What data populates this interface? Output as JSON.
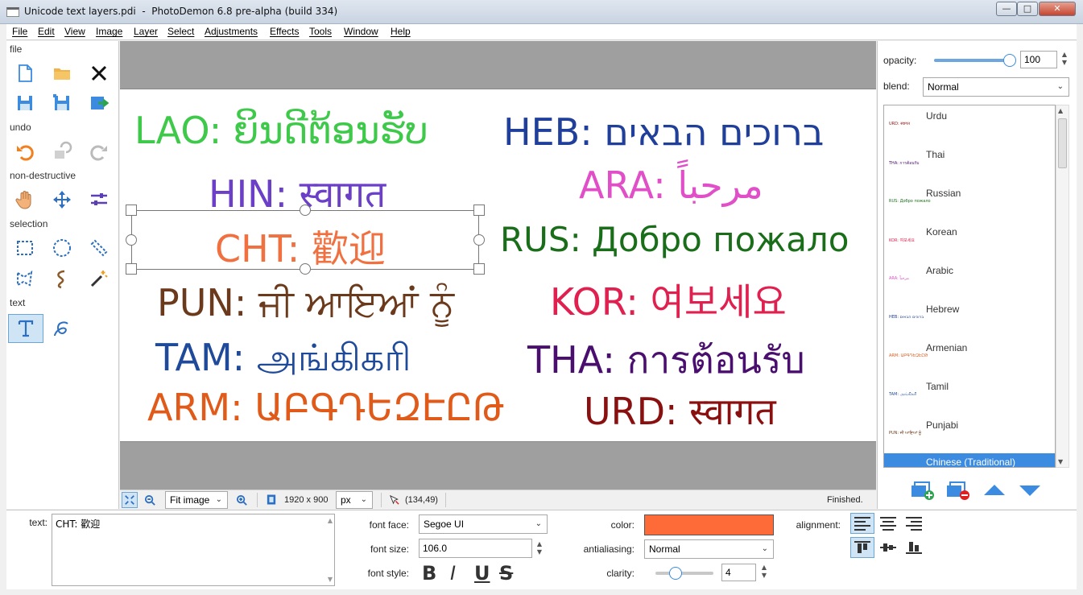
{
  "window": {
    "title": "Unicode text layers.pdi  -  PhotoDemon 6.8 pre-alpha (build 334)",
    "minimize": "—",
    "maximize": "□",
    "close": "✕"
  },
  "menu": [
    "File",
    "Edit",
    "View",
    "Image",
    "Layer",
    "Select",
    "Adjustments",
    "Effects",
    "Tools",
    "Window",
    "Help"
  ],
  "toolbox": {
    "sections": {
      "file": "file",
      "undo": "undo",
      "nondestructive": "non-destructive",
      "selection": "selection",
      "text": "text"
    }
  },
  "canvas": {
    "layers": [
      {
        "text": "LAO: ຍິນດີຕ້ອນຮັບ",
        "color": "#3fc94a"
      },
      {
        "text": "HEB: ברוכים הבאים",
        "color": "#1f3f9a"
      },
      {
        "text": "HIN: स्वागत",
        "color": "#6b3fc7"
      },
      {
        "text": "ARA: مرحباً",
        "color": "#e04fc8"
      },
      {
        "text": "CHT: 歡迎",
        "color": "#f07040"
      },
      {
        "text": "RUS: Добро пожало",
        "color": "#1a6e1a"
      },
      {
        "text": "PUN: ਜੀ ਆਇਆਂ ਨੂੰ",
        "color": "#6b3a1c"
      },
      {
        "text": "KOR: 여보세요",
        "color": "#e0204f"
      },
      {
        "text": "TAM: அங்கிகரி",
        "color": "#1f4a9a"
      },
      {
        "text": "THA: การต้อนรับ",
        "color": "#4a0f6e"
      },
      {
        "text": "ARM: ԱԲԳԴԵԶԷԸԹ",
        "color": "#e05a1a"
      },
      {
        "text": "URD: स्वागत",
        "color": "#8a1010"
      }
    ]
  },
  "statusbar": {
    "zoom": "Fit image",
    "size": "1920 x 900",
    "unit": "px",
    "coords": "(134,49)",
    "status": "Finished."
  },
  "layers_panel": {
    "opacity_label": "opacity:",
    "opacity_value": "100",
    "opacity_level": 1.0,
    "blend_label": "blend:",
    "blend_value": "Normal",
    "items": [
      {
        "name": "Urdu",
        "thumb": "URD: स्वागत",
        "color": "#8a1010"
      },
      {
        "name": "Thai",
        "thumb": "THA: การต้อนรับ",
        "color": "#4a0f6e"
      },
      {
        "name": "Russian",
        "thumb": "RUS: Добро пожало",
        "color": "#1a6e1a"
      },
      {
        "name": "Korean",
        "thumb": "KOR: 여보세요",
        "color": "#e0204f"
      },
      {
        "name": "Arabic",
        "thumb": "ARA: مرحباً",
        "color": "#e04fc8"
      },
      {
        "name": "Hebrew",
        "thumb": "HEB: ברוכים הבאים",
        "color": "#1f3f9a"
      },
      {
        "name": "Armenian",
        "thumb": "ARM: ԱԲԳԴԵԶԷԸԹ",
        "color": "#e05a1a"
      },
      {
        "name": "Tamil",
        "thumb": "TAM: அங்கிகரி",
        "color": "#1f4a9a"
      },
      {
        "name": "Punjabi",
        "thumb": "PUN: ਜੀ ਆਇਆਂ ਨੂੰ",
        "color": "#6b3a1c"
      },
      {
        "name": "Chinese (Traditional)",
        "thumb": "",
        "color": "#ffffff"
      }
    ]
  },
  "options": {
    "text_label": "text:",
    "text_value": "CHT: 歡迎",
    "font_face_label": "font face:",
    "font_face": "Segoe UI",
    "font_size_label": "font size:",
    "font_size": "106.0",
    "font_style_label": "font style:",
    "style_buttons": [
      "B",
      "I",
      "U",
      "S"
    ],
    "color_label": "color:",
    "color_value": "#ff6a39",
    "antialiasing_label": "antialiasing:",
    "antialiasing": "Normal",
    "clarity_label": "clarity:",
    "clarity": "4",
    "clarity_level": 0.3,
    "alignment_label": "alignment:"
  }
}
